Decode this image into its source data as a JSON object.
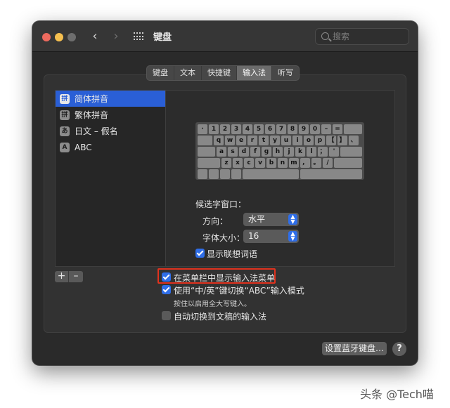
{
  "window": {
    "title": "键盘",
    "search_placeholder": "搜索"
  },
  "tabs": [
    "键盘",
    "文本",
    "快捷键",
    "输入法",
    "听写"
  ],
  "active_tab": "输入法",
  "input_sources": [
    {
      "label": "简体拼音",
      "icon": "拼",
      "selected": true
    },
    {
      "label": "繁体拼音",
      "icon": "拼",
      "selected": false
    },
    {
      "label": "日文 – 假名",
      "icon": "あ",
      "selected": false
    },
    {
      "label": "ABC",
      "icon": "A",
      "selected": false
    }
  ],
  "keyboard": {
    "row1": [
      "·",
      "1",
      "2",
      "3",
      "4",
      "5",
      "6",
      "7",
      "8",
      "9",
      "0",
      "–",
      "="
    ],
    "row2": [
      "q",
      "w",
      "e",
      "r",
      "t",
      "y",
      "u",
      "i",
      "o",
      "p",
      "【",
      "】",
      "、"
    ],
    "row3": [
      "a",
      "s",
      "d",
      "f",
      "g",
      "h",
      "j",
      "k",
      "l",
      "；",
      "'"
    ],
    "row4": [
      "z",
      "x",
      "c",
      "v",
      "b",
      "n",
      "m",
      "，",
      "。",
      "/"
    ]
  },
  "candidate_window": {
    "label": "候选字窗口：",
    "direction_label": "方向：",
    "direction_value": "水平",
    "font_size_label": "字体大小：",
    "font_size_value": "16",
    "show_predictive_label": "显示联想词语",
    "show_predictive_checked": true
  },
  "list_controls": {
    "add": "+",
    "remove": "–"
  },
  "options": {
    "menu_bar_label": "在菜单栏中显示输入法菜单",
    "menu_bar_checked": true,
    "toggle_abc_label": "使用“中/英”键切换“ABC”输入模式",
    "toggle_abc_checked": true,
    "caps_note": "按住以启用全大写键入。",
    "auto_switch_label": "自动切换到文稿的输入法",
    "auto_switch_checked": false
  },
  "footer": {
    "bluetooth_button": "设置蓝牙键盘…",
    "help": "?"
  },
  "watermark": "头条 @Tech喵",
  "colors": {
    "accent": "#2f6ee8",
    "selection": "#2a5fd6",
    "highlight_box": "#e0321e"
  }
}
